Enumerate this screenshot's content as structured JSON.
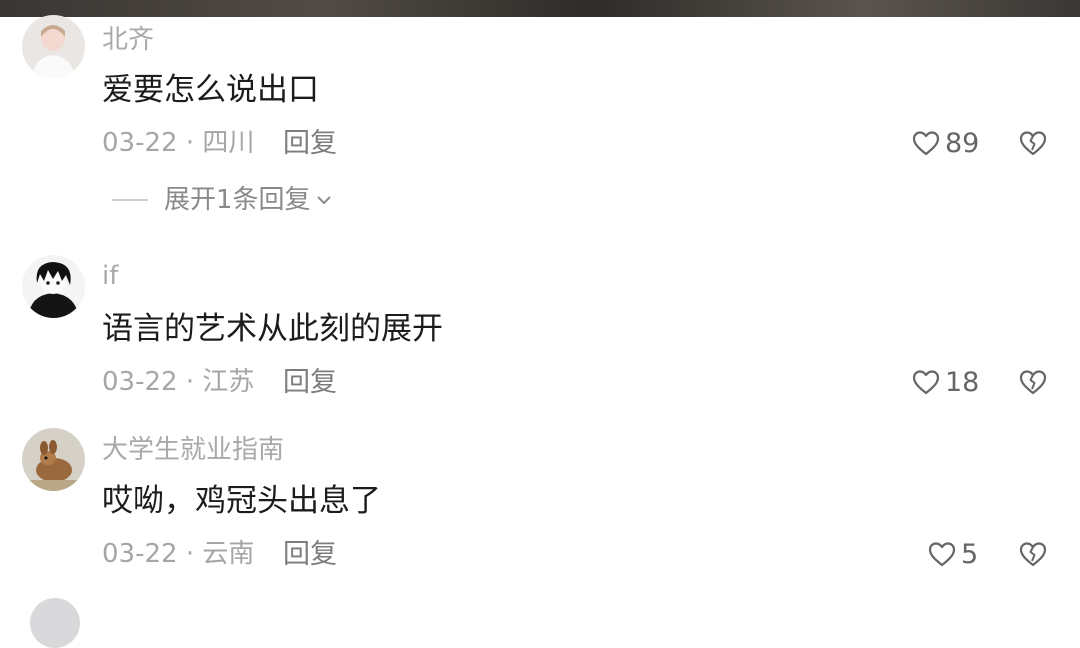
{
  "comments": [
    {
      "username": "北齐",
      "text": "爱要怎么说出口",
      "date": "03-22",
      "location": "四川",
      "reply_label": "回复",
      "likes": "89",
      "expand_replies": "展开1条回复"
    },
    {
      "username": "if",
      "text": "语言的艺术从此刻的展开",
      "date": "03-22",
      "location": "江苏",
      "reply_label": "回复",
      "likes": "18"
    },
    {
      "username": "大学生就业指南",
      "text": "哎呦，鸡冠头出息了",
      "date": "03-22",
      "location": "云南",
      "reply_label": "回复",
      "likes": "5"
    }
  ],
  "meta_separator": "·",
  "icons": {
    "like": "heart-outline-icon",
    "dislike": "broken-heart-icon",
    "expand": "chevron-down-icon"
  },
  "colors": {
    "text_primary": "#1c1c1c",
    "text_secondary": "#a6a6a6"
  }
}
